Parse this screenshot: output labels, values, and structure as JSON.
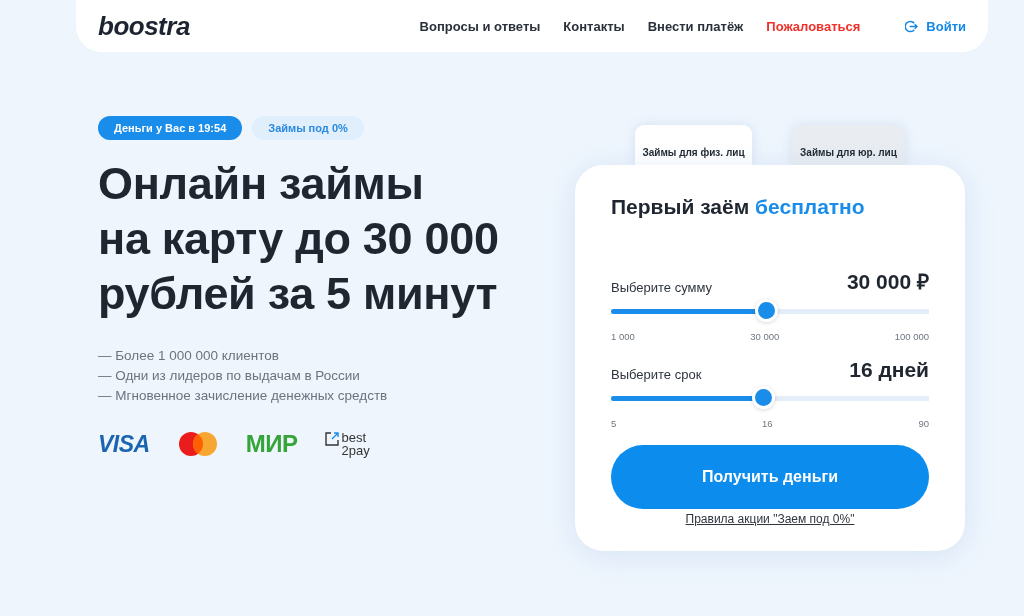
{
  "header": {
    "logo": "boostra",
    "nav": [
      {
        "label": "Вопросы и ответы",
        "accent": false
      },
      {
        "label": "Контакты",
        "accent": false
      },
      {
        "label": "Внести платёж",
        "accent": false
      },
      {
        "label": "Пожаловаться",
        "accent": true
      }
    ],
    "login": "Войти"
  },
  "hero": {
    "badges": [
      {
        "label": "Деньги у Вас в 19:54",
        "kind": "primary"
      },
      {
        "label": "Займы под 0%",
        "kind": "secondary"
      }
    ],
    "heading": [
      "Онлайн займы",
      "на карту до 30 000",
      "рублей за 5 минут"
    ],
    "bullets": [
      "— Более 1 000 000 клиентов",
      "— Одни из лидеров по выдачам в России",
      "— Мгновенное зачисление денежных средств"
    ],
    "payment_logos": [
      {
        "kind": "visa",
        "text": "VISA"
      },
      {
        "kind": "mastercard"
      },
      {
        "kind": "mir",
        "text": "МИР"
      },
      {
        "kind": "best2pay",
        "lines": [
          "best",
          "2pay"
        ]
      }
    ]
  },
  "card": {
    "tabs": [
      {
        "label": "Займы для физ. лиц",
        "selected": true
      },
      {
        "label": "Займы для юр. лиц",
        "selected": false
      }
    ],
    "title": "Первый заём",
    "title_accent": "бесплатно",
    "sliders": [
      {
        "label": "Выберите сумму",
        "value": "30 000 ₽",
        "level": 0.49,
        "ticks": [
          "1 000",
          "30 000",
          "100 000"
        ]
      },
      {
        "label": "Выберите срок",
        "value": "16 дней",
        "level": 0.48,
        "ticks": [
          "5",
          "16",
          "90"
        ]
      }
    ],
    "button": "Получить деньги",
    "rules_link": "Правила акции \"Заем под 0%\""
  }
}
